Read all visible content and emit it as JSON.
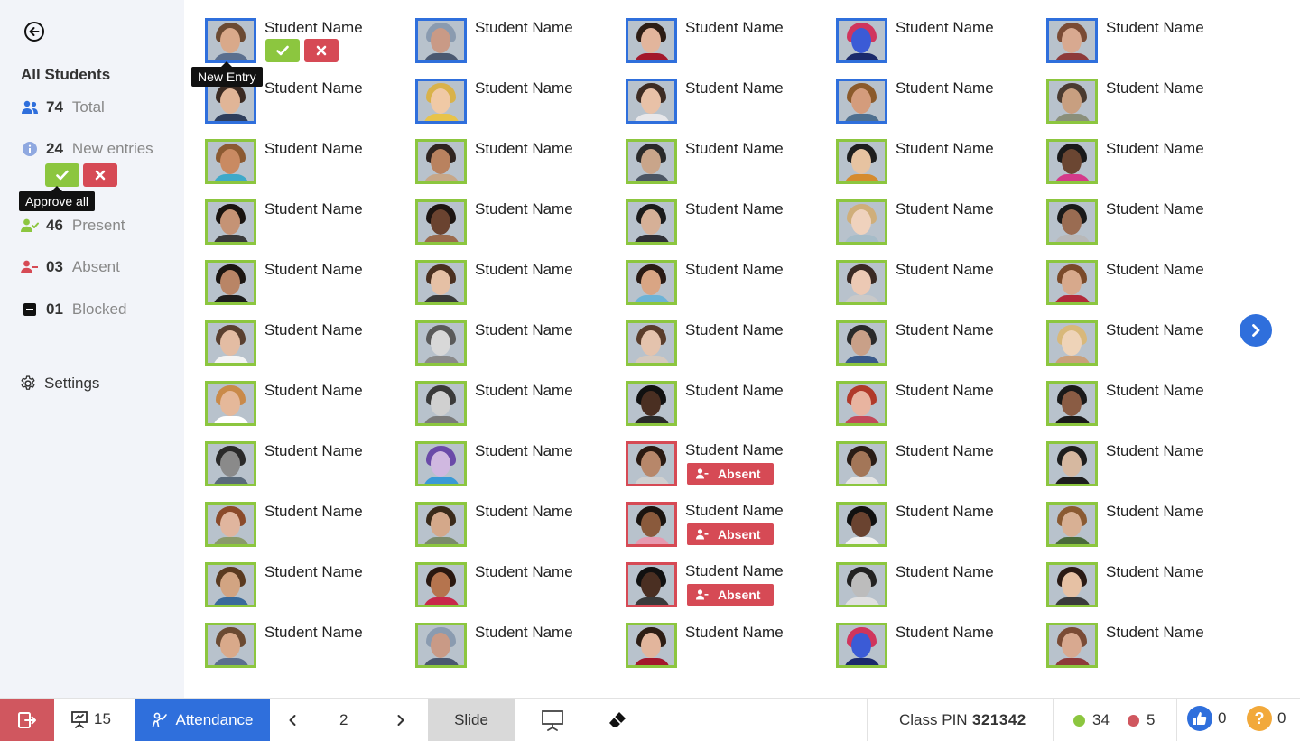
{
  "sidebar": {
    "title": "All Students",
    "stats": {
      "total": {
        "num": "74",
        "label": "Total"
      },
      "new": {
        "num": "24",
        "label": "New entries"
      },
      "present": {
        "num": "46",
        "label": "Present"
      },
      "absent": {
        "num": "03",
        "label": "Absent"
      },
      "blocked": {
        "num": "01",
        "label": "Blocked"
      }
    },
    "approve_all_tooltip": "Approve all",
    "settings_label": "Settings"
  },
  "grid": {
    "new_entry_tooltip": "New Entry",
    "absent_label": "Absent",
    "students": [
      {
        "name": "Student Name",
        "status": "new",
        "skin": "#d9a98a",
        "hair": "#6b4a32",
        "shirt": "#5b6f8e"
      },
      {
        "name": "Student Name",
        "status": "new",
        "skin": "#c99a86",
        "hair": "#8a9bb0",
        "shirt": "#4a5870"
      },
      {
        "name": "Student Name",
        "status": "new",
        "skin": "#e2b59c",
        "hair": "#2d1d14",
        "shirt": "#a3182c"
      },
      {
        "name": "Student Name",
        "status": "new",
        "skin": "#3b5bd6",
        "hair": "#d0355d",
        "shirt": "#1b2a6b"
      },
      {
        "name": "Student Name",
        "status": "new",
        "skin": "#d8a990",
        "hair": "#7a4b35",
        "shirt": "#8d3a3a"
      },
      {
        "name": "Student Name",
        "status": "new",
        "skin": "#e0b597",
        "hair": "#3a2a22",
        "shirt": "#2e3e5c"
      },
      {
        "name": "Student Name",
        "status": "new",
        "skin": "#f0c9a5",
        "hair": "#d9b24a",
        "shirt": "#e8c34a"
      },
      {
        "name": "Student Name",
        "status": "new",
        "skin": "#e8c1a7",
        "hair": "#3d2c23",
        "shirt": "#e7e7ea"
      },
      {
        "name": "Student Name",
        "status": "new",
        "skin": "#d49c7c",
        "hair": "#8b5a2b",
        "shirt": "#4e6f8f"
      },
      {
        "name": "Student Name",
        "status": "present",
        "skin": "#c89f80",
        "hair": "#4a3b30",
        "shirt": "#8a8f7a"
      },
      {
        "name": "Student Name",
        "status": "present",
        "skin": "#c98a62",
        "hair": "#8b5a32",
        "shirt": "#3fa9c9"
      },
      {
        "name": "Student Name",
        "status": "present",
        "skin": "#b9825f",
        "hair": "#2f2420",
        "shirt": "#c7a788"
      },
      {
        "name": "Student Name",
        "status": "present",
        "skin": "#c9a58a",
        "hair": "#2a2a2a",
        "shirt": "#4b5563"
      },
      {
        "name": "Student Name",
        "status": "present",
        "skin": "#e7c3a1",
        "hair": "#1e1e1e",
        "shirt": "#d58b2e"
      },
      {
        "name": "Student Name",
        "status": "present",
        "skin": "#6b4632",
        "hair": "#1a1a1a",
        "shirt": "#d43a8a"
      },
      {
        "name": "Student Name",
        "status": "present",
        "skin": "#c59375",
        "hair": "#1a1410",
        "shirt": "#3a3a3a"
      },
      {
        "name": "Student Name",
        "status": "present",
        "skin": "#6a4330",
        "hair": "#1d1512",
        "shirt": "#9a6a4d"
      },
      {
        "name": "Student Name",
        "status": "present",
        "skin": "#d6b097",
        "hair": "#1b1b1b",
        "shirt": "#2f2f35"
      },
      {
        "name": "Student Name",
        "status": "present",
        "skin": "#efd2bd",
        "hair": "#cfae7a",
        "shirt": "#a6bcc8"
      },
      {
        "name": "Student Name",
        "status": "present",
        "skin": "#9a6c52",
        "hair": "#1a1a1a",
        "shirt": "#b8b8b8"
      },
      {
        "name": "Student Name",
        "status": "present",
        "skin": "#b98566",
        "hair": "#1c1612",
        "shirt": "#1e1e1e"
      },
      {
        "name": "Student Name",
        "status": "present",
        "skin": "#e5c0a5",
        "hair": "#4a3020",
        "shirt": "#3b3b3b"
      },
      {
        "name": "Student Name",
        "status": "present",
        "skin": "#d9a584",
        "hair": "#2a1b15",
        "shirt": "#6db3d6"
      },
      {
        "name": "Student Name",
        "status": "present",
        "skin": "#ecc9b4",
        "hair": "#3a2a24",
        "shirt": "#c9c9c9"
      },
      {
        "name": "Student Name",
        "status": "present",
        "skin": "#d7a98c",
        "hair": "#7a4a2a",
        "shirt": "#b22a3a"
      },
      {
        "name": "Student Name",
        "status": "present",
        "skin": "#e3bca3",
        "hair": "#5a4030",
        "shirt": "#f4f4f4"
      },
      {
        "name": "Student Name",
        "status": "present",
        "skin": "#d8d8d8",
        "hair": "#5a5a5a",
        "shirt": "#8a8a8a"
      },
      {
        "name": "Student Name",
        "status": "present",
        "skin": "#e4c3ad",
        "hair": "#5a3d2b",
        "shirt": "#d6c9bd"
      },
      {
        "name": "Student Name",
        "status": "present",
        "skin": "#c9a088",
        "hair": "#2a2a2a",
        "shirt": "#3a5a8a"
      },
      {
        "name": "Student Name",
        "status": "present",
        "skin": "#eed3b8",
        "hair": "#d8b87a",
        "shirt": "#caa07a"
      },
      {
        "name": "Student Name",
        "status": "present",
        "skin": "#e5b89a",
        "hair": "#c98a4a",
        "shirt": "#ffffff"
      },
      {
        "name": "Student Name",
        "status": "present",
        "skin": "#d0d0d0",
        "hair": "#3a3a3a",
        "shirt": "#7a7a7a"
      },
      {
        "name": "Student Name",
        "status": "present",
        "skin": "#4a2f22",
        "hair": "#111111",
        "shirt": "#2a2a2a"
      },
      {
        "name": "Student Name",
        "status": "present",
        "skin": "#e8b4a0",
        "hair": "#b03a2a",
        "shirt": "#c24a5a"
      },
      {
        "name": "Student Name",
        "status": "present",
        "skin": "#8a5c44",
        "hair": "#1a1a1a",
        "shirt": "#1a1a1a"
      },
      {
        "name": "Student Name",
        "status": "present",
        "skin": "#8a8a8a",
        "hair": "#2a2a2a",
        "shirt": "#5a6a7a"
      },
      {
        "name": "Student Name",
        "status": "present",
        "skin": "#d0b8e0",
        "hair": "#6a4aa8",
        "shirt": "#3a9ad6"
      },
      {
        "name": "Student Name",
        "status": "absent",
        "skin": "#b7876a",
        "hair": "#2a1a12",
        "shirt": "#d0d0d0"
      },
      {
        "name": "Student Name",
        "status": "present",
        "skin": "#a37658",
        "hair": "#2a1d16",
        "shirt": "#e6e6e6"
      },
      {
        "name": "Student Name",
        "status": "present",
        "skin": "#d6b8a0",
        "hair": "#1e1e1e",
        "shirt": "#1e1e1e"
      },
      {
        "name": "Student Name",
        "status": "present",
        "skin": "#e0b59e",
        "hair": "#8a4a2a",
        "shirt": "#8a9a6a"
      },
      {
        "name": "Student Name",
        "status": "present",
        "skin": "#d4a88a",
        "hair": "#3a2a1a",
        "shirt": "#7a8a6a"
      },
      {
        "name": "Student Name",
        "status": "absent",
        "skin": "#8a5a3c",
        "hair": "#1a1410",
        "shirt": "#e69ab0"
      },
      {
        "name": "Student Name",
        "status": "present",
        "skin": "#6a4330",
        "hair": "#111111",
        "shirt": "#f2f2f2"
      },
      {
        "name": "Student Name",
        "status": "present",
        "skin": "#d8b094",
        "hair": "#8a5a32",
        "shirt": "#4a6a3a"
      },
      {
        "name": "Student Name",
        "status": "present",
        "skin": "#d2a482",
        "hair": "#5a3a20",
        "shirt": "#3a6a9a"
      },
      {
        "name": "Student Name",
        "status": "present",
        "skin": "#b5744e",
        "hair": "#2a1810",
        "shirt": "#c8284a"
      },
      {
        "name": "Student Name",
        "status": "absent",
        "skin": "#4a2f22",
        "hair": "#111111",
        "shirt": "#3a3a3a"
      },
      {
        "name": "Student Name",
        "status": "present",
        "skin": "#bcbcbc",
        "hair": "#222222",
        "shirt": "#e0e0e0"
      },
      {
        "name": "Student Name",
        "status": "present",
        "skin": "#e6c1a4",
        "hair": "#2a1a14",
        "shirt": "#3a3a3a"
      },
      {
        "name": "Student Name",
        "status": "present",
        "skin": "#d9a98a",
        "hair": "#6b4a32",
        "shirt": "#5b6f8e"
      },
      {
        "name": "Student Name",
        "status": "present",
        "skin": "#c99a86",
        "hair": "#8a9bb0",
        "shirt": "#4a5870"
      },
      {
        "name": "Student Name",
        "status": "present",
        "skin": "#e2b59c",
        "hair": "#2d1d14",
        "shirt": "#a3182c"
      },
      {
        "name": "Student Name",
        "status": "present",
        "skin": "#3b5bd6",
        "hair": "#d0355d",
        "shirt": "#1b2a6b"
      },
      {
        "name": "Student Name",
        "status": "present",
        "skin": "#d8a990",
        "hair": "#7a4b35",
        "shirt": "#8d3a3a"
      }
    ]
  },
  "footer": {
    "presentation_count": "15",
    "attendance_label": "Attendance",
    "page_number": "2",
    "slide_label": "Slide",
    "class_pin_label": "Class PIN",
    "class_pin_value": "321342",
    "green_count": "34",
    "red_count": "5",
    "likes_count": "0",
    "questions_count": "0"
  },
  "colors": {
    "present": "#8cc63f",
    "new": "#2f6fdc",
    "absent": "#d64a55",
    "accent": "#2f6fdc",
    "question": "#f2a93b"
  }
}
